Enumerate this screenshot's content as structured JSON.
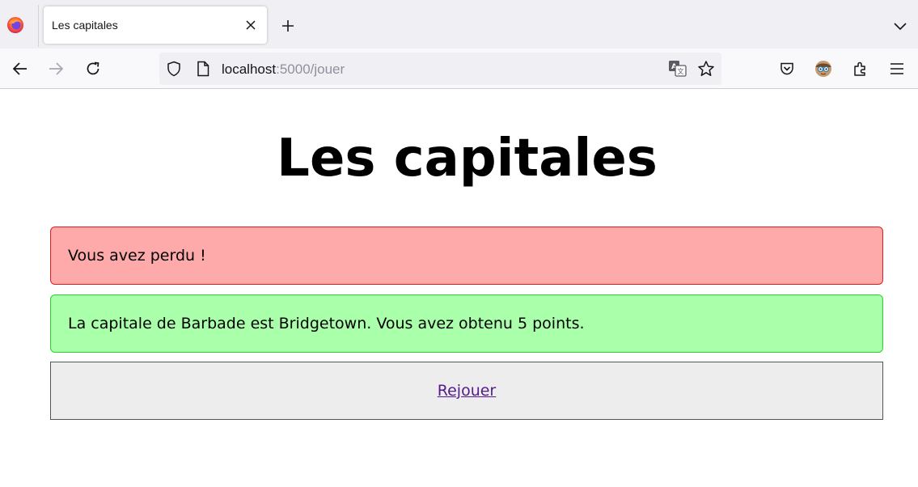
{
  "browser": {
    "tab": {
      "title": "Les capitales"
    },
    "address_bar": {
      "host": "localhost",
      "path": ":5000/jouer"
    },
    "icons": {
      "app": "firefox-logo-icon",
      "close_tab": "close-icon",
      "new_tab": "plus-icon",
      "tab_list": "chevron-down-icon",
      "back": "arrow-left-icon",
      "forward": "arrow-right-icon",
      "reload": "reload-icon",
      "security": "shield-icon",
      "page_info": "page-icon",
      "translate": "translate-icon",
      "bookmark": "star-icon",
      "pocket": "pocket-icon",
      "account": "avatar-icon",
      "extensions": "puzzle-icon",
      "menu": "hamburger-menu-icon"
    }
  },
  "page": {
    "title": "Les capitales",
    "error_message": "Vous avez perdu !",
    "result_message": "La capitale de Barbade est Bridgetown. Vous avez obtenu 5 points.",
    "replay_link": "Rejouer"
  },
  "colors": {
    "error_bg": "#ffaaaa",
    "error_border": "#e02020",
    "success_bg": "#aaffaa",
    "success_border": "#33cc33",
    "link_visited": "#551a8b"
  }
}
